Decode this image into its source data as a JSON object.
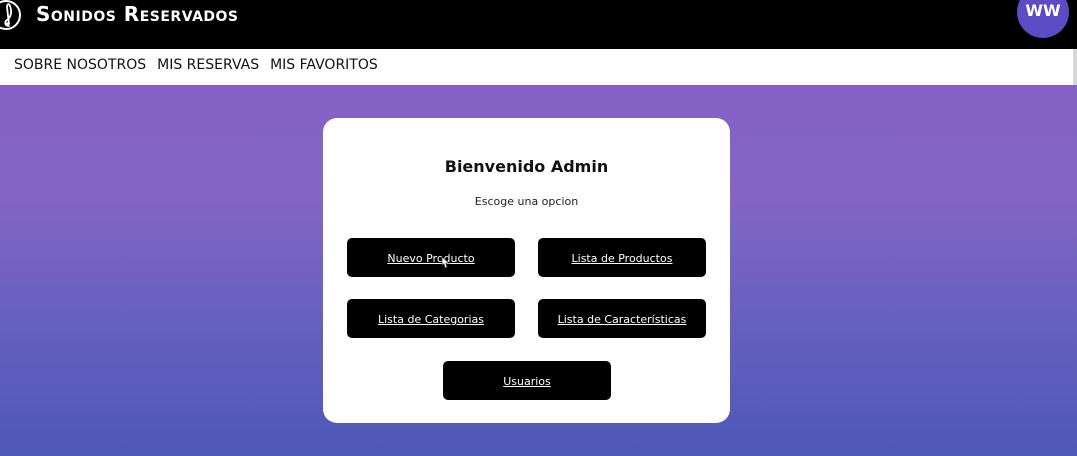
{
  "header": {
    "brand": "Sonidos Reservados",
    "logo_icon": "treble-clef-icon",
    "avatar_initials": "WW"
  },
  "nav": {
    "items": [
      {
        "label": "SOBRE NOSOTROS"
      },
      {
        "label": "MIS RESERVAS"
      },
      {
        "label": "MIS FAVORITOS"
      }
    ]
  },
  "card": {
    "title": "Bienvenido Admin",
    "subtitle": "Escoge una opcion",
    "buttons": [
      {
        "label": "Nuevo Producto"
      },
      {
        "label": "Lista de Productos"
      },
      {
        "label": "Lista de Categorias"
      },
      {
        "label": "Lista de Características"
      },
      {
        "label": "Usuarios"
      }
    ]
  },
  "colors": {
    "topbar": "#000000",
    "avatar": "#5b4bc4",
    "gradient_top": "#8662c6",
    "gradient_bottom": "#4d58b7",
    "button": "#000000"
  }
}
